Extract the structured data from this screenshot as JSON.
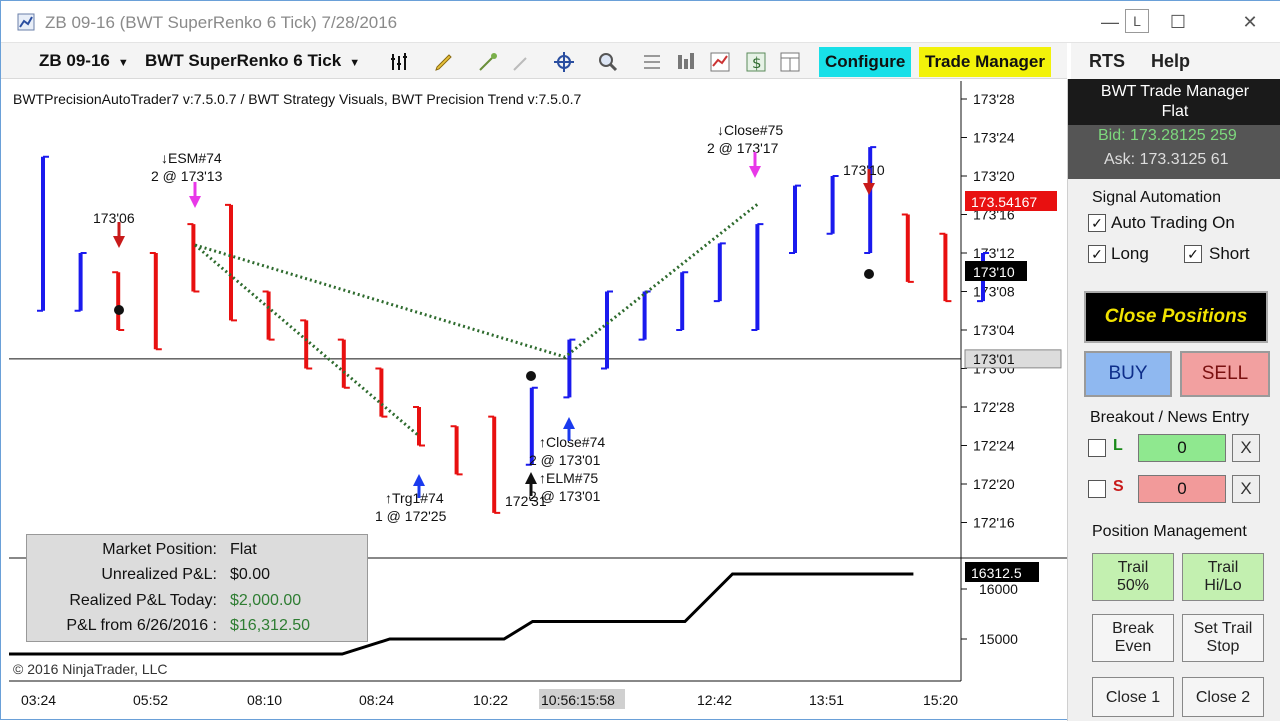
{
  "window": {
    "title": "ZB 09-16 (BWT SuperRenko  6 Tick)  7/28/2016",
    "minimize": "—",
    "link_badge": "L",
    "maximize": "☐",
    "close": "✕"
  },
  "toolbar": {
    "instrument": "ZB 09-16",
    "period": "BWT SuperRenko  6 Tick",
    "configure_label": "Configure",
    "trade_manager_label": "Trade Manager"
  },
  "menu": {
    "rts": "RTS",
    "help": "Help"
  },
  "chart": {
    "strategy_label": "BWTPrecisionAutoTrader7 v:7.5.0.7 / BWT Strategy Visuals, BWT Precision Trend v:7.5.0.7",
    "copyright": "© 2016 NinjaTrader, LLC"
  },
  "chart_data": {
    "type": "bar",
    "title": "",
    "price_axis_ticks": [
      "173'28",
      "173'24",
      "173'20",
      "173'16",
      "173'12",
      "173'08",
      "173'04",
      "173'00",
      "172'28",
      "172'24",
      "172'20",
      "172'16"
    ],
    "pnl_axis_ticks": [
      "16000",
      "15000"
    ],
    "time_ticks": [
      "03:24",
      "05:52",
      "08:10",
      "08:24",
      "10:22",
      "12:42",
      "13:51",
      "15:20"
    ],
    "cursor_time": "10:56:15:58",
    "markers": {
      "last_price": "173.54167",
      "current_price": "173'10",
      "crosshair_price": "173'01",
      "pnl_value": "16312.5"
    },
    "annotations": [
      {
        "text": "↓ESM#74",
        "sub": "2 @ 173'13"
      },
      {
        "text": "173'06",
        "sub": ""
      },
      {
        "text": "↓Close#75",
        "sub": "2 @ 173'17"
      },
      {
        "text": "173'10",
        "sub": ""
      },
      {
        "text": "↑Trg1#74",
        "sub": "1 @ 172'25"
      },
      {
        "text": "↑Close#74",
        "sub": "2 @ 173'01"
      },
      {
        "text": "↑ELM#75",
        "sub": "2 @ 173'01"
      },
      {
        "text": "172'31",
        "sub": ""
      }
    ],
    "bars": [
      {
        "dir": "up",
        "open": 173.06,
        "close": 173.22
      },
      {
        "dir": "up",
        "open": 173.06,
        "close": 173.12
      },
      {
        "dir": "down",
        "open": 173.1,
        "close": 173.04
      },
      {
        "dir": "down",
        "open": 173.12,
        "close": 173.02
      },
      {
        "dir": "down",
        "open": 173.15,
        "close": 173.08
      },
      {
        "dir": "down",
        "open": 173.17,
        "close": 173.05
      },
      {
        "dir": "down",
        "open": 173.08,
        "close": 173.03
      },
      {
        "dir": "down",
        "open": 173.05,
        "close": 173.0
      },
      {
        "dir": "down",
        "open": 173.03,
        "close": 172.3
      },
      {
        "dir": "down",
        "open": 173.0,
        "close": 172.27
      },
      {
        "dir": "down",
        "open": 172.28,
        "close": 172.24
      },
      {
        "dir": "down",
        "open": 172.26,
        "close": 172.21
      },
      {
        "dir": "down",
        "open": 172.27,
        "close": 172.17
      },
      {
        "dir": "up",
        "open": 172.22,
        "close": 172.3
      },
      {
        "dir": "up",
        "open": 172.29,
        "close": 173.03
      },
      {
        "dir": "up",
        "open": 173.0,
        "close": 173.08
      },
      {
        "dir": "up",
        "open": 173.03,
        "close": 173.08
      },
      {
        "dir": "up",
        "open": 173.04,
        "close": 173.1
      },
      {
        "dir": "up",
        "open": 173.07,
        "close": 173.13
      },
      {
        "dir": "up",
        "open": 173.04,
        "close": 173.15
      },
      {
        "dir": "up",
        "open": 173.12,
        "close": 173.19
      },
      {
        "dir": "up",
        "open": 173.14,
        "close": 173.2
      },
      {
        "dir": "up",
        "open": 173.12,
        "close": 173.23
      },
      {
        "dir": "down",
        "open": 173.16,
        "close": 173.09
      },
      {
        "dir": "down",
        "open": 173.14,
        "close": 173.07
      },
      {
        "dir": "up",
        "open": 173.07,
        "close": 173.12
      }
    ],
    "pnl_curve": [
      {
        "t": 0.0,
        "v": 14700
      },
      {
        "t": 0.35,
        "v": 14700
      },
      {
        "t": 0.4,
        "v": 15000
      },
      {
        "t": 0.52,
        "v": 15000
      },
      {
        "t": 0.55,
        "v": 15350
      },
      {
        "t": 0.71,
        "v": 15350
      },
      {
        "t": 0.76,
        "v": 16300
      },
      {
        "t": 0.95,
        "v": 16300
      }
    ]
  },
  "pnl_box": {
    "market_position_label": "Market Position:",
    "market_position_value": "Flat",
    "unrealized_label": "Unrealized P&L:",
    "unrealized_value": "$0.00",
    "realized_label": "Realized P&L Today:",
    "realized_value": "$2,000.00",
    "period_label": "P&L from 6/26/2016 :",
    "period_value": "$16,312.50"
  },
  "trade_manager": {
    "title": "BWT Trade Manager",
    "status": "Flat",
    "bid": "Bid: 173.28125 259",
    "ask": "Ask: 173.3125 61",
    "signal_automation_title": "Signal Automation",
    "auto_trading_label": "Auto Trading On",
    "long_label": "Long",
    "short_label": "Short",
    "check_mark": "✓",
    "close_positions_label": "Close Positions",
    "buy_label": "BUY",
    "sell_label": "SELL",
    "breakout_title": "Breakout / News Entry",
    "l_label": "L",
    "s_label": "S",
    "l_value": "0",
    "s_value": "0",
    "clear_label": "X",
    "position_mgmt_title": "Position Management",
    "trail50_line1": "Trail",
    "trail50_line2": "50%",
    "trailhilo_line1": "Trail",
    "trailhilo_line2": "Hi/Lo",
    "break_even_line1": "Break",
    "break_even_line2": "Even",
    "set_trail_line1": "Set Trail",
    "set_trail_line2": "Stop",
    "close1_label": "Close 1",
    "close2_label": "Close 2"
  },
  "colors": {
    "up_bar": "#1a1aee",
    "down_bar": "#e81010",
    "trend_dots": "#2e6b2e",
    "configure_bg": "#18e0e8",
    "trade_manager_bg": "#f2f20a",
    "last_price_bg": "#e81010",
    "current_price_bg": "#000000"
  }
}
